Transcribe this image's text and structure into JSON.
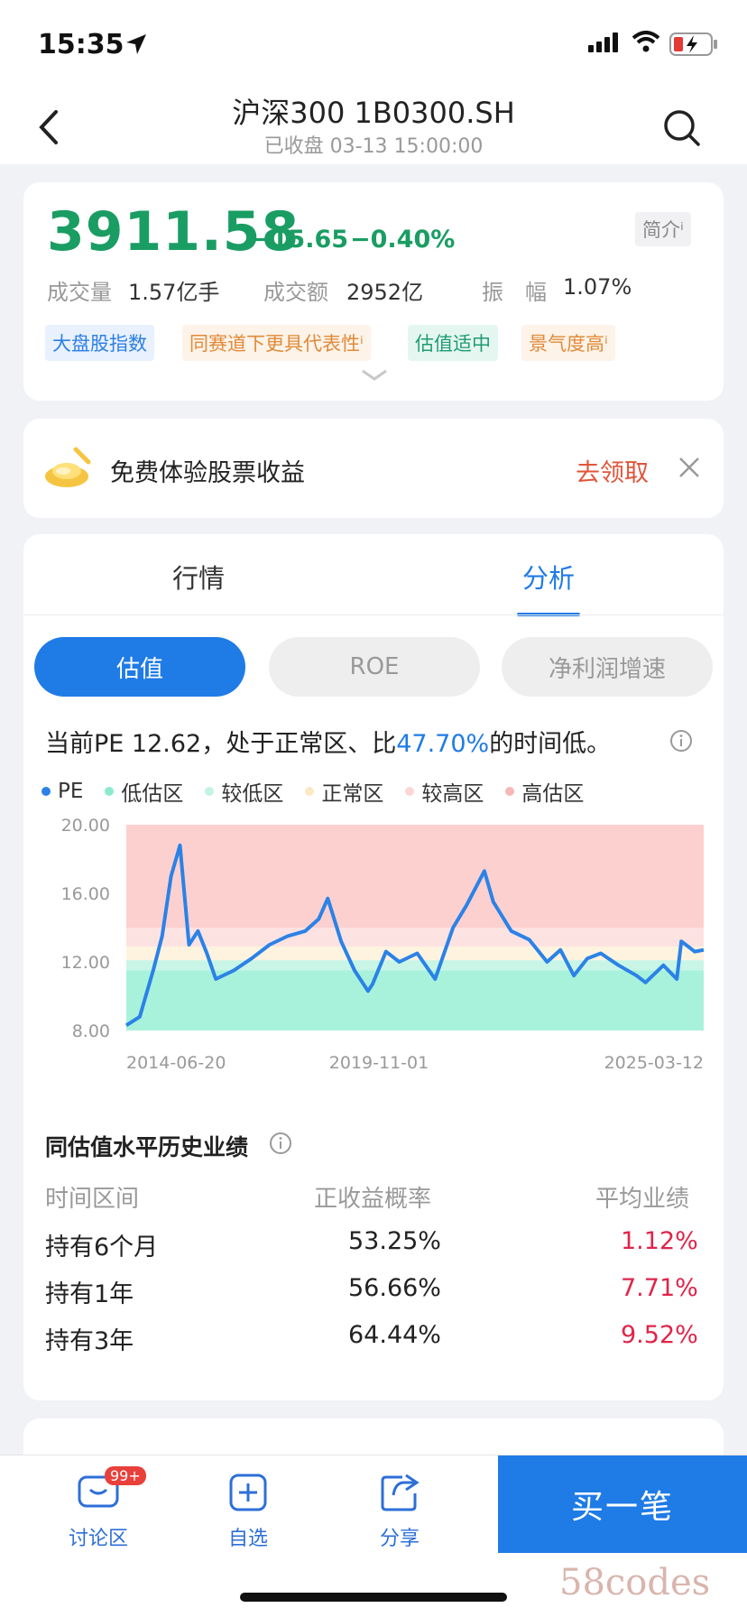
{
  "status_bar": {
    "time": "15:35"
  },
  "header": {
    "title": "沪深300 1B0300.SH",
    "subtitle": "已收盘 03-13 15:00:00"
  },
  "quote": {
    "price": "3911.58",
    "change": "−15.65",
    "change_pct": "−0.40%",
    "intro_label": "简介ⁱ",
    "volume_label": "成交量",
    "volume_value": "1.57亿手",
    "amount_label": "成交额",
    "amount_value": "2952亿",
    "amplitude_label": "振　幅",
    "amplitude_value": "1.07%",
    "tags": [
      "大盘股指数",
      "同赛道下更具代表性ⁱ",
      "估值适中",
      "景气度高ⁱ"
    ],
    "colors": {
      "down": "#1a9d63"
    }
  },
  "promo": {
    "text": "免费体验股票收益",
    "action": "去领取"
  },
  "analysis": {
    "tabs": [
      "行情",
      "分析"
    ],
    "segments": [
      "估值",
      "ROE",
      "净利润增速"
    ],
    "pe_prefix": "当前PE 12.62，处于正常区、比",
    "pe_highlight": "47.70%",
    "pe_suffix": "的时间低。",
    "legend": [
      "PE",
      "低估区",
      "较低区",
      "正常区",
      "较高区",
      "高估区"
    ],
    "history_title": "同估值水平历史业绩",
    "table_headers": [
      "时间区间",
      "正收益概率",
      "平均业绩"
    ],
    "table_rows": [
      [
        "持有6个月",
        "53.25%",
        "1.12%"
      ],
      [
        "持有1年",
        "56.66%",
        "7.71%"
      ],
      [
        "持有3年",
        "64.44%",
        "9.52%"
      ]
    ]
  },
  "chart_data": {
    "type": "line",
    "title": "",
    "xlabel": "",
    "ylabel": "",
    "ylim": [
      8,
      20
    ],
    "y_ticks": [
      "20.00",
      "16.00",
      "12.00",
      "8.00"
    ],
    "x_ticks": [
      "2014-06-20",
      "2019-11-01",
      "2025-03-12"
    ],
    "zones": [
      {
        "name": "低估区",
        "from": 8,
        "to": 11.5,
        "color": "#a8f2dc"
      },
      {
        "name": "较低区",
        "from": 11.5,
        "to": 12.1,
        "color": "#c9f5e6"
      },
      {
        "name": "正常区",
        "from": 12.1,
        "to": 12.9,
        "color": "#fdf3de"
      },
      {
        "name": "较高区",
        "from": 12.9,
        "to": 14.0,
        "color": "#fde2e2"
      },
      {
        "name": "高估区",
        "from": 14.0,
        "to": 20,
        "color": "#fdd0d0"
      }
    ],
    "series": [
      {
        "name": "PE",
        "color": "#2b82e6",
        "x": [
          "2014-06",
          "2014-09",
          "2014-12",
          "2015-02",
          "2015-04",
          "2015-06",
          "2015-08",
          "2015-10",
          "2015-12",
          "2016-02",
          "2016-06",
          "2016-10",
          "2017-02",
          "2017-06",
          "2017-10",
          "2018-01",
          "2018-03",
          "2018-06",
          "2018-09",
          "2018-12",
          "2019-01",
          "2019-04",
          "2019-07",
          "2019-11",
          "2020-03",
          "2020-07",
          "2020-10",
          "2021-02",
          "2021-04",
          "2021-08",
          "2021-12",
          "2022-04",
          "2022-07",
          "2022-10",
          "2023-01",
          "2023-04",
          "2023-08",
          "2023-12",
          "2024-02",
          "2024-06",
          "2024-09",
          "2024-10",
          "2025-01",
          "2025-03"
        ],
        "values": [
          8.3,
          8.8,
          11.5,
          13.5,
          17.0,
          18.8,
          13.0,
          13.8,
          12.5,
          11.0,
          11.5,
          12.2,
          13.0,
          13.5,
          13.8,
          14.5,
          15.7,
          13.2,
          11.5,
          10.3,
          10.7,
          12.6,
          12.0,
          12.5,
          11.0,
          14.0,
          15.3,
          17.3,
          15.5,
          13.8,
          13.3,
          12.0,
          12.7,
          11.2,
          12.2,
          12.5,
          11.8,
          11.2,
          10.8,
          11.8,
          11.0,
          13.2,
          12.6,
          12.7
        ]
      }
    ]
  }
}
